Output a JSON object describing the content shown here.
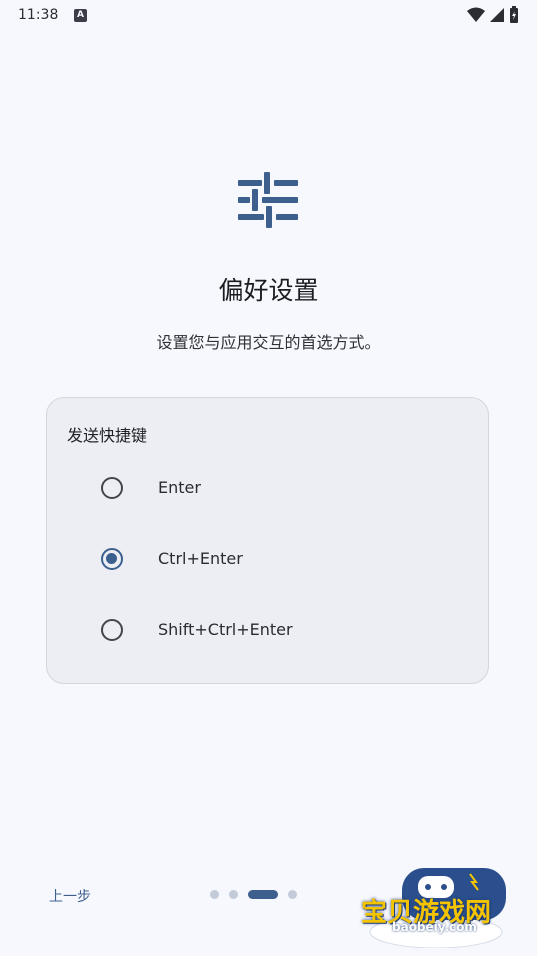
{
  "status": {
    "time": "11:38",
    "badge": "A"
  },
  "page": {
    "title": "偏好设置",
    "subtitle": "设置您与应用交互的首选方式。"
  },
  "card": {
    "title": "发送快捷键",
    "options": [
      {
        "label": "Enter",
        "selected": false
      },
      {
        "label": "Ctrl+Enter",
        "selected": true
      },
      {
        "label": "Shift+Ctrl+Enter",
        "selected": false
      }
    ]
  },
  "footer": {
    "back_label": "上一步",
    "page_count": 4,
    "current_page": 3
  },
  "watermark": {
    "text": "宝贝游戏网",
    "url": "baobeiy.com"
  },
  "colors": {
    "accent": "#3c5f8e",
    "background": "#f7f8fd",
    "card": "#eceef3"
  }
}
